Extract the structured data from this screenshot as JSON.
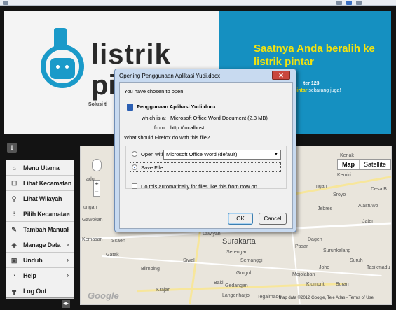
{
  "banner": {
    "brand_line1": "listrik",
    "brand_line2": "pi",
    "brand_sub": "Solusi tl",
    "promo_title": "Saatnya Anda beralih ke listrik pintar",
    "promo_num": "ter 123",
    "promo_line_b": "pintar",
    "promo_line_rest": " sekarang juga!"
  },
  "sidebar": {
    "items": [
      {
        "label": "Menu Utama",
        "icon": "home-icon",
        "glyph": "⌂",
        "arrow": false
      },
      {
        "label": "Lihat Kecamatan",
        "icon": "square-icon",
        "glyph": "☐",
        "arrow": false
      },
      {
        "label": "Lihat Wilayah",
        "icon": "search-icon",
        "glyph": "⚲",
        "arrow": false
      },
      {
        "label": "Pilih Kecamatan",
        "icon": "sliders-icon",
        "glyph": "⫶",
        "arrow": true
      },
      {
        "label": "Tambah Manual",
        "icon": "edit-icon",
        "glyph": "✎",
        "arrow": true
      },
      {
        "label": "Manage Data",
        "icon": "tag-icon",
        "glyph": "◈",
        "arrow": true
      },
      {
        "label": "Unduh",
        "icon": "download-icon",
        "glyph": "▣",
        "arrow": true
      },
      {
        "label": "Help",
        "icon": "help-icon",
        "glyph": "◔",
        "arrow": true
      },
      {
        "label": "Log Out",
        "icon": "logout-icon",
        "glyph": "┳",
        "arrow": false
      }
    ],
    "arrow_glyph": "›"
  },
  "map": {
    "type_map": "Map",
    "type_satellite": "Satellite",
    "labels": {
      "surakarta": "Surakarta",
      "kemiri": "Kemiri",
      "desa_b": "Desa B",
      "sroyo": "Sroyo",
      "alastuwo": "Alastuwo",
      "jebres": "Jebres",
      "jaten": "Jaten",
      "lawiyan": "Lawiyan",
      "kemasan": "Kemasan",
      "scaen": "Scaen",
      "gatak": "Gatak",
      "serengan": "Serengan",
      "semanggi": "Semanggi",
      "pasar": "Pasar",
      "dagen": "Dagen",
      "suruhkalang": "Suruhkalang",
      "suruh": "Suruh",
      "tasikmadu": "Tasikmadu",
      "siwal": "Siwal",
      "joho": "Joho",
      "blimbing": "Blimbing",
      "grogol": "Grogol",
      "mojolaban": "Mojolaban",
      "krajan": "Krajan",
      "baki": "Baki",
      "gedangan": "Gedangan",
      "klumprit": "Klumprit",
      "buran": "Buran",
      "langenharjo": "Langenharjo",
      "tegalmade": "Tegalmade",
      "gawokan": "Gawokan",
      "ungan": "ungan",
      "ngan": "ngan",
      "kenak": "Kenak",
      "ado": "ado"
    },
    "copyright": "Map data ©2012 Google, Tele Atlas - ",
    "terms": "Terms of Use",
    "google": "Google"
  },
  "dialog": {
    "title": "Opening Penggunaan Aplikasi Yudi.docx",
    "close_glyph": "✕",
    "chosen": "You have chosen to open:",
    "filename": "Penggunaan Aplikasi Yudi.docx",
    "which_is": "which is a:",
    "which_is_value": "Microsoft Office Word Document (2.3 MB)",
    "from": "from:",
    "from_value": "http://localhost",
    "question": "What should Firefox do with this file?",
    "open_with": "Open with",
    "open_with_value": "Microsoft Office Word (default)",
    "save_file": "Save File",
    "auto": "Do this automatically for files like this from now on.",
    "ok": "OK",
    "cancel": "Cancel",
    "dropdown_glyph": "▼"
  },
  "chrome": {
    "toggle_glyph": "⇕",
    "collapse_glyph": "◂▸"
  }
}
